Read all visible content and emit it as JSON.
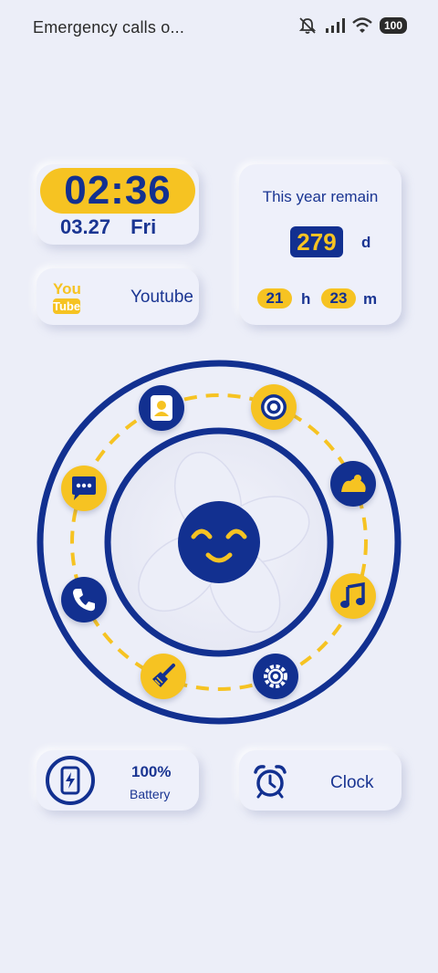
{
  "status_bar": {
    "text": "Emergency calls o...",
    "battery": "100",
    "icons": [
      "mute-icon",
      "signal-icon",
      "wifi-icon",
      "battery-icon"
    ]
  },
  "clock_widget": {
    "time": "02:36",
    "date": "03.27",
    "weekday": "Fri"
  },
  "youtube_widget": {
    "logo_top": "You",
    "logo_bottom": "Tube",
    "label": "Youtube"
  },
  "year_widget": {
    "title": "This year remain",
    "days": "279",
    "days_unit": "d",
    "hours": "21",
    "hours_unit": "h",
    "minutes": "23",
    "minutes_unit": "m"
  },
  "wheel": {
    "apps": [
      "contacts-icon",
      "camera-icon",
      "gallery-icon",
      "music-icon",
      "settings-icon",
      "cleaner-icon",
      "phone-icon",
      "messages-icon"
    ],
    "center": "smiley-face-icon"
  },
  "battery_widget": {
    "percent": "100%",
    "label": "Battery"
  },
  "clock_app": {
    "label": "Clock"
  },
  "colors": {
    "accent": "#f6c322",
    "primary": "#123090",
    "background": "#eceef8"
  }
}
